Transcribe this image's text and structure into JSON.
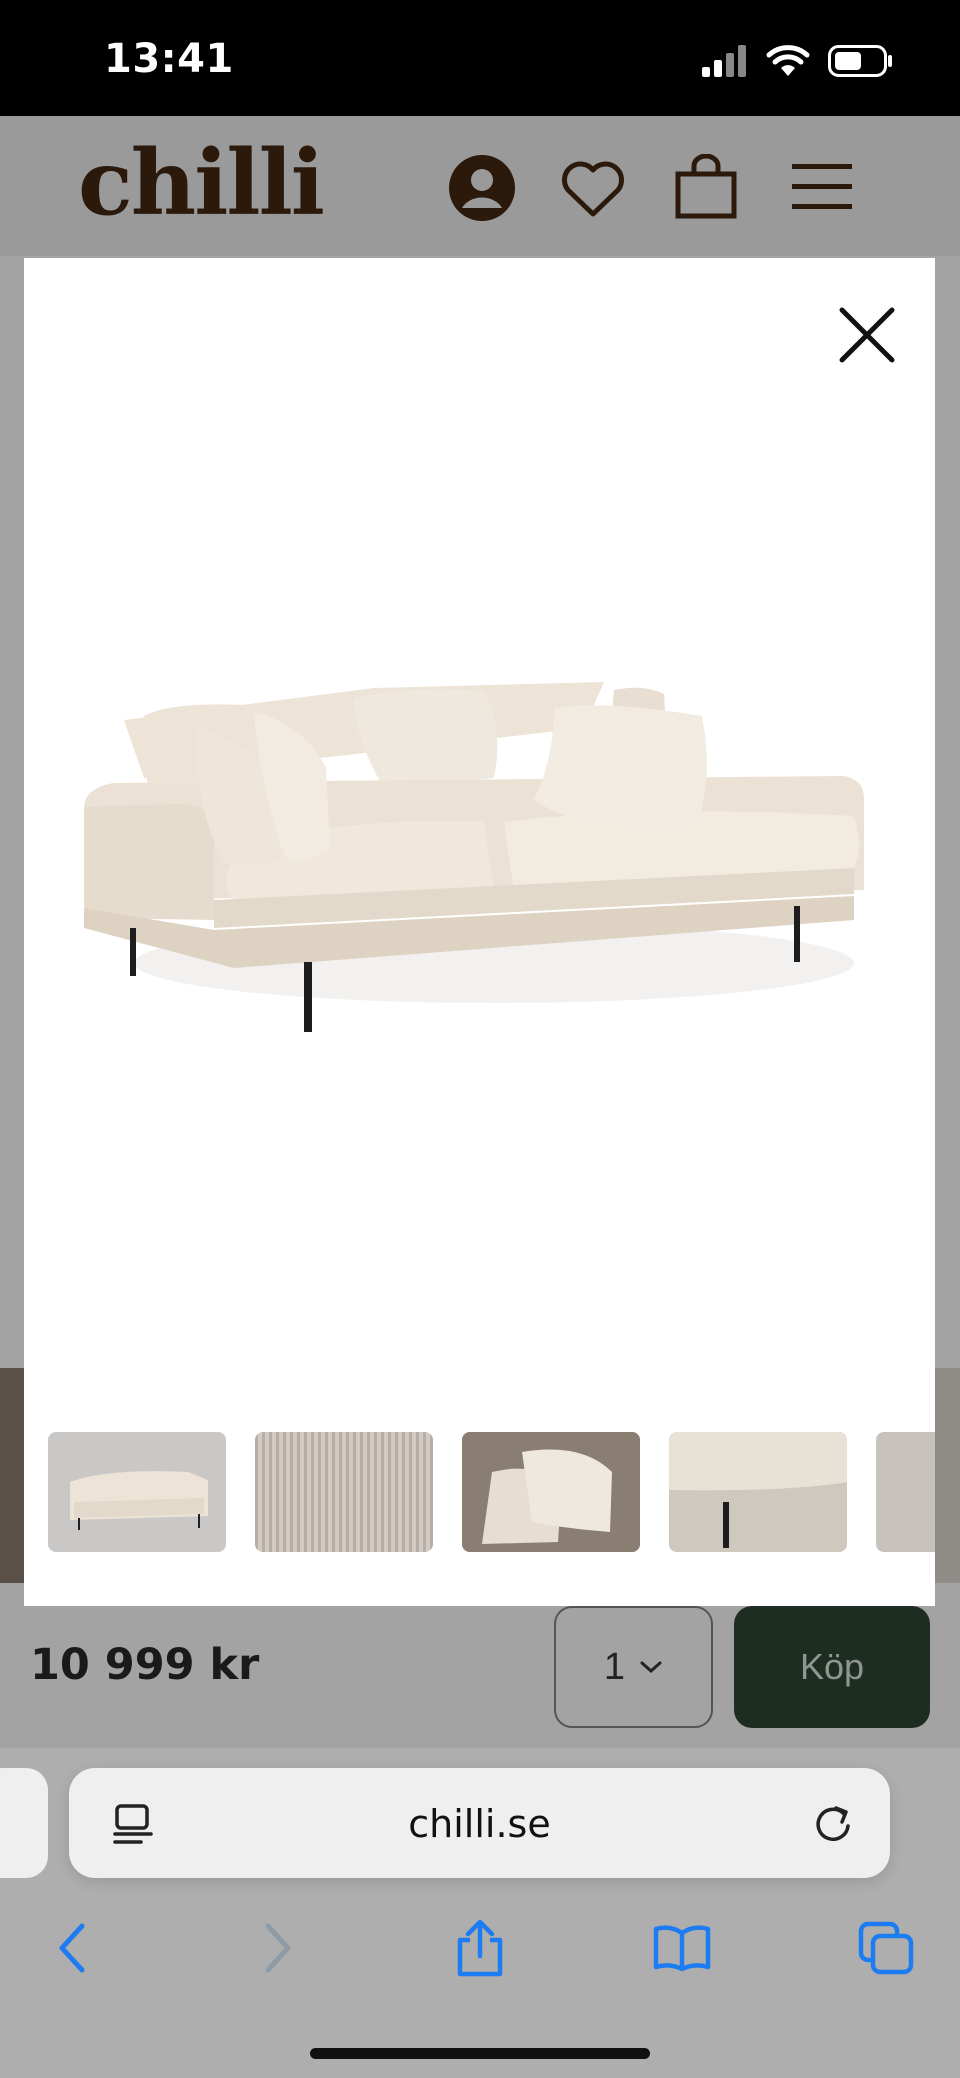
{
  "status_bar": {
    "time": "13:41"
  },
  "header": {
    "logo_text": "chilli"
  },
  "product": {
    "price": "10 999 kr",
    "quantity": "1",
    "buy_label": "Köp"
  },
  "browser": {
    "url": "chilli.se"
  },
  "colors": {
    "brand_brown": "#2b1a0c",
    "buy_button": "#1e2d22",
    "ios_blue": "#1e7cf2"
  },
  "icons": [
    "user-icon",
    "heart-icon",
    "bag-icon",
    "menu-icon",
    "close-icon",
    "chevron-down-icon",
    "reader-icon",
    "reload-icon",
    "back-icon",
    "forward-icon",
    "share-icon",
    "bookmarks-icon",
    "tabs-icon"
  ]
}
